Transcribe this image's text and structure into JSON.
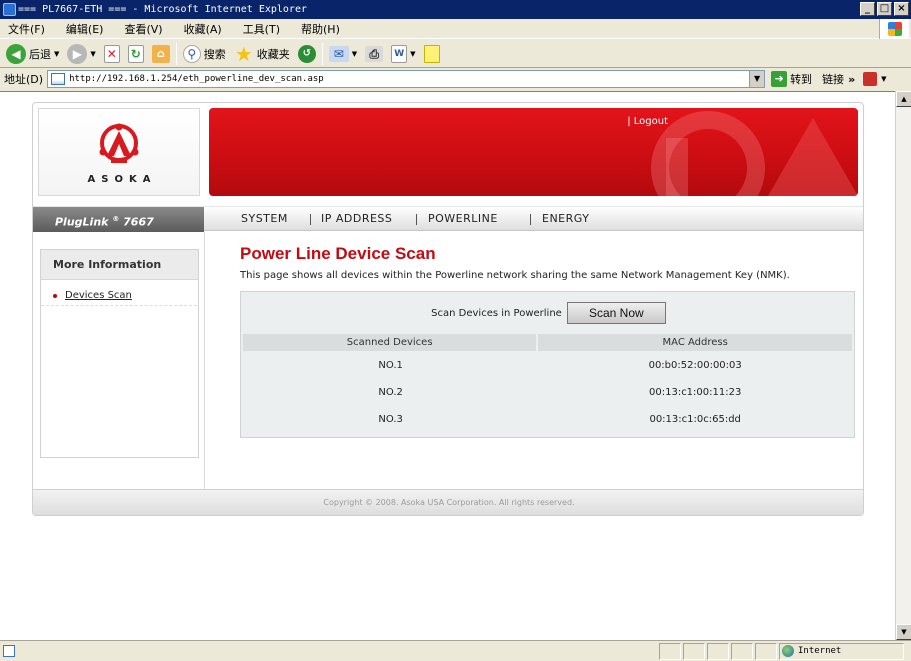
{
  "window": {
    "title": "=== PL7667-ETH === - Microsoft Internet Explorer",
    "controls": [
      "_",
      "□",
      "×"
    ]
  },
  "menubar": {
    "items": [
      "文件(F)",
      "编辑(E)",
      "查看(V)",
      "收藏(A)",
      "工具(T)",
      "帮助(H)"
    ]
  },
  "toolbar": {
    "back_label": "后退",
    "search_label": "搜索",
    "favorites_label": "收藏夹"
  },
  "addressbar": {
    "label": "地址(D)",
    "url": "http://192.168.1.254/eth_powerline_dev_scan.asp",
    "go_label": "转到",
    "links_label": "链接"
  },
  "statusbar": {
    "zone": "Internet"
  },
  "site": {
    "logo_text": "ASOKA",
    "logout_label": "| Logout",
    "brand": "PlugLink",
    "brand_reg": "®",
    "brand_model": " 7667",
    "nav": [
      "SYSTEM",
      "IP ADDRESS",
      "POWERLINE",
      "ENERGY"
    ],
    "sidebar": {
      "heading": "More Information",
      "item": "Devices Scan"
    },
    "content": {
      "title": "Power Line Device Scan",
      "description": "This page shows all devices within the Powerline network sharing the same Network Management Key (NMK).",
      "scan_label": "Scan Devices in Powerline",
      "scan_button": "Scan Now",
      "table": {
        "headers": [
          "Scanned Devices",
          "MAC Address"
        ],
        "rows": [
          [
            "NO.1",
            "00:b0:52:00:00:03"
          ],
          [
            "NO.2",
            "00:13:c1:00:11:23"
          ],
          [
            "NO.3",
            "00:13:c1:0c:65:dd"
          ]
        ]
      }
    },
    "footer": "Copyright © 2008. Asoka USA Corporation. All rights reserved."
  }
}
